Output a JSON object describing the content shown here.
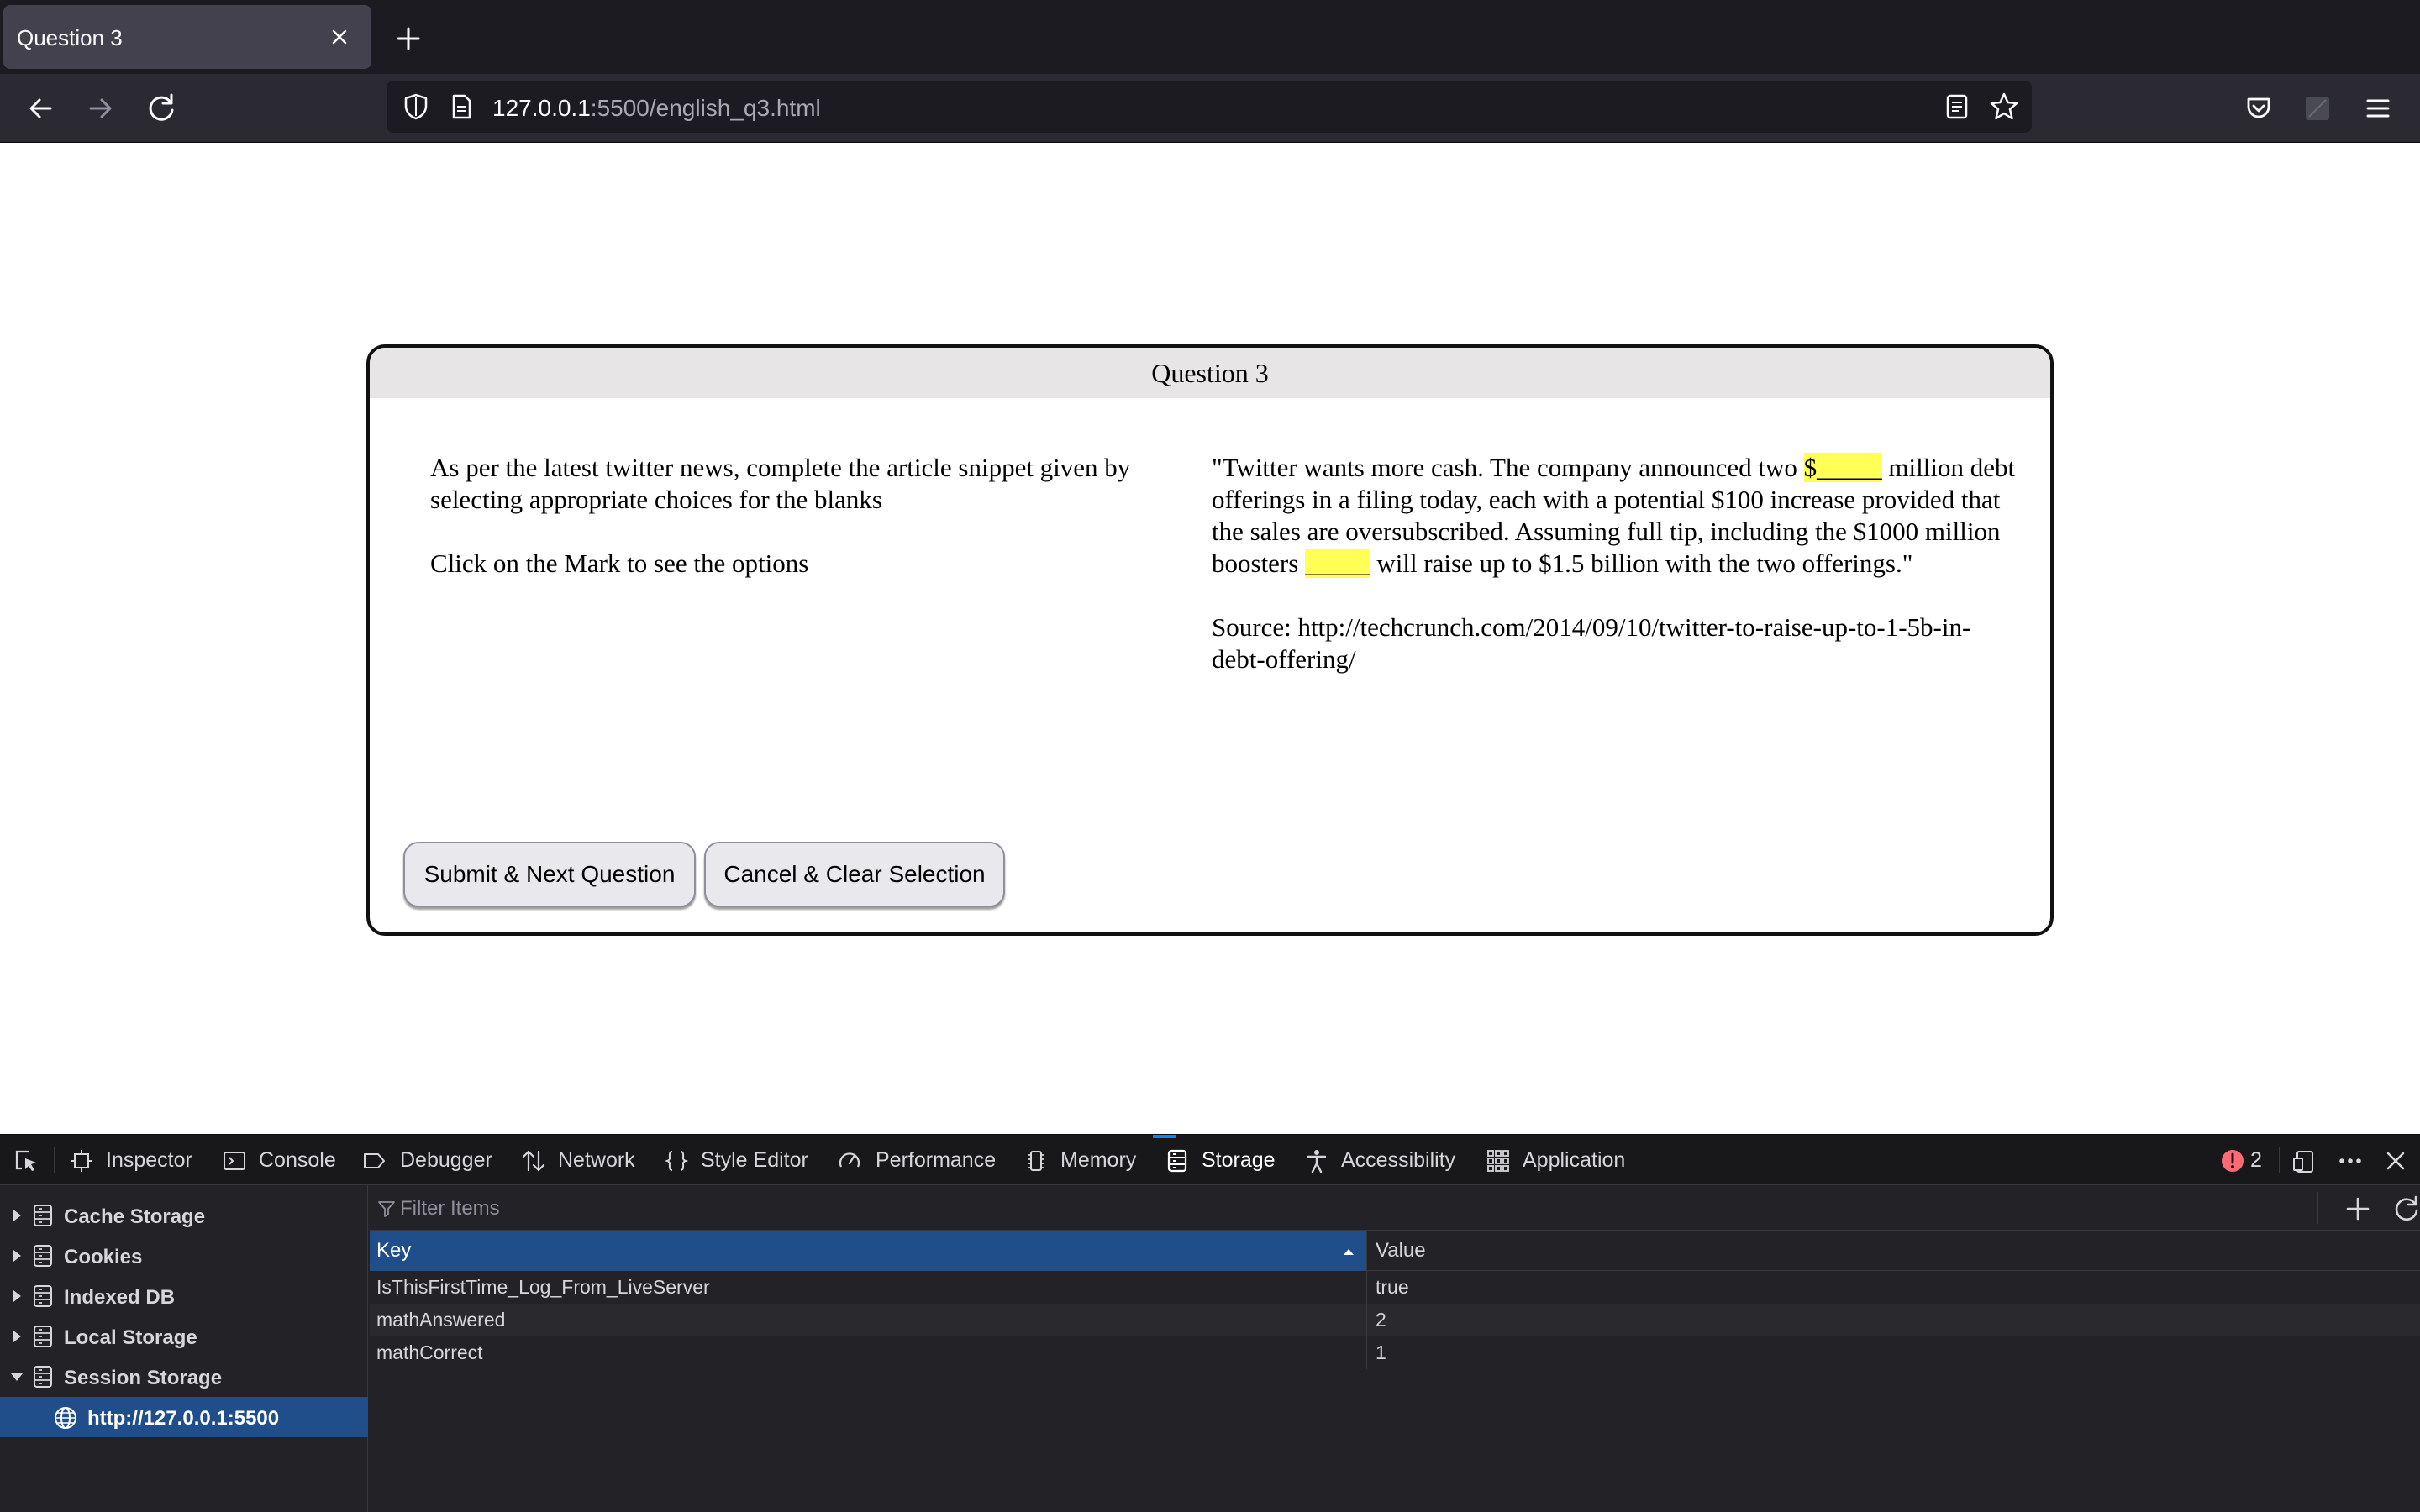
{
  "browser": {
    "tab_title": "Question 3",
    "url_host": "127.0.0.1",
    "url_rest": ":5500/english_q3.html"
  },
  "question": {
    "title": "Question 3",
    "instructions": "As per the latest twitter news, complete the article snippet given by selecting appropriate choices for the blanks",
    "hint": "Click on the Mark to see the options",
    "snippet_part1": "\"Twitter wants more cash. The company announced two ",
    "blank1": "$_____",
    "snippet_part2": " million debt offerings in a filing today, each with a potential $100 increase provided that the sales are oversubscribed. Assuming full tip, including the $1000 million boosters ",
    "blank2": "_____",
    "snippet_part3": " will raise up to $1.5 billion with the two offerings.\"",
    "source": "Source: http://techcrunch.com/2014/09/10/twitter-to-raise-up-to-1-5b-in-debt-offering/",
    "submit_label": "Submit & Next Question",
    "cancel_label": "Cancel & Clear Selection"
  },
  "devtools": {
    "tabs": {
      "inspector": "Inspector",
      "console": "Console",
      "debugger": "Debugger",
      "network": "Network",
      "style_editor": "Style Editor",
      "performance": "Performance",
      "memory": "Memory",
      "storage": "Storage",
      "accessibility": "Accessibility",
      "application": "Application"
    },
    "error_count": "2",
    "sidebar": {
      "cache_storage": "Cache Storage",
      "cookies": "Cookies",
      "indexed_db": "Indexed DB",
      "local_storage": "Local Storage",
      "session_storage": "Session Storage",
      "session_origin": "http://127.0.0.1:5500"
    },
    "filter_placeholder": "Filter Items",
    "table": {
      "col_key": "Key",
      "col_value": "Value",
      "rows": [
        {
          "key": "IsThisFirstTime_Log_From_LiveServer",
          "value": "true"
        },
        {
          "key": "mathAnswered",
          "value": "2"
        },
        {
          "key": "mathCorrect",
          "value": "1"
        }
      ]
    }
  }
}
